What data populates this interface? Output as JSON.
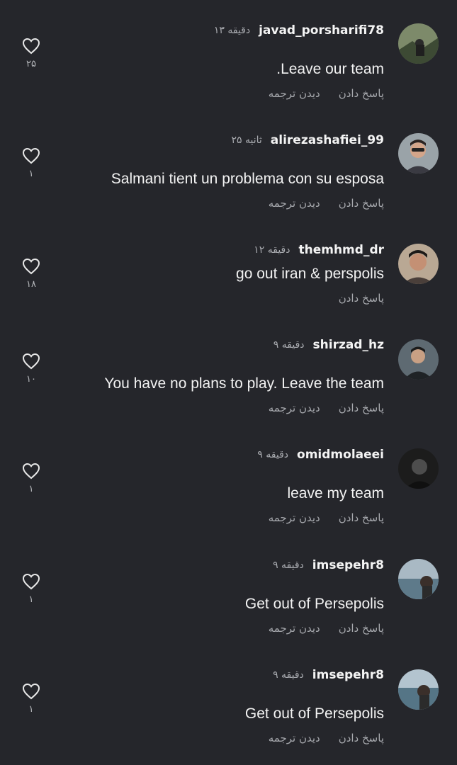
{
  "comments": [
    {
      "username": "javad_porsharifi78",
      "time": "۱۳ دقیقه",
      "text": ".Leave our team",
      "reply": "پاسخ دادن",
      "translate": "دیدن ترجمه",
      "likes": "۲۵"
    },
    {
      "username": "alirezashafiei_99",
      "time": "۲۵ ثانیه",
      "text": "Salmani tient un problema con su esposa",
      "reply": "پاسخ دادن",
      "translate": "دیدن ترجمه",
      "likes": "۱"
    },
    {
      "username": "themhmd_dr",
      "time": "۱۲ دقیقه",
      "text": "go out iran & perspolis",
      "reply": "پاسخ دادن",
      "translate": "",
      "likes": "۱۸"
    },
    {
      "username": "shirzad_hz",
      "time": "۹ دقیقه",
      "text": "You have no plans to play. Leave the team",
      "reply": "پاسخ دادن",
      "translate": "دیدن ترجمه",
      "likes": "۱۰"
    },
    {
      "username": "omidmolaeei",
      "time": "۹ دقیقه",
      "text": "leave my team",
      "reply": "پاسخ دادن",
      "translate": "دیدن ترجمه",
      "likes": "۱"
    },
    {
      "username": "imsepehr8",
      "time": "۹ دقیقه",
      "text": "Get out of Persepolis",
      "reply": "پاسخ دادن",
      "translate": "دیدن ترجمه",
      "likes": "۱"
    },
    {
      "username": "imsepehr8",
      "time": "۹ دقیقه",
      "text": "Get out of Persepolis",
      "reply": "پاسخ دادن",
      "translate": "دیدن ترجمه",
      "likes": "۱"
    }
  ],
  "colors": {
    "background": "#25262b",
    "text": "#f2f2f2",
    "muted": "#a6a8ad"
  },
  "icons": {
    "like": "heart-outline-icon"
  }
}
